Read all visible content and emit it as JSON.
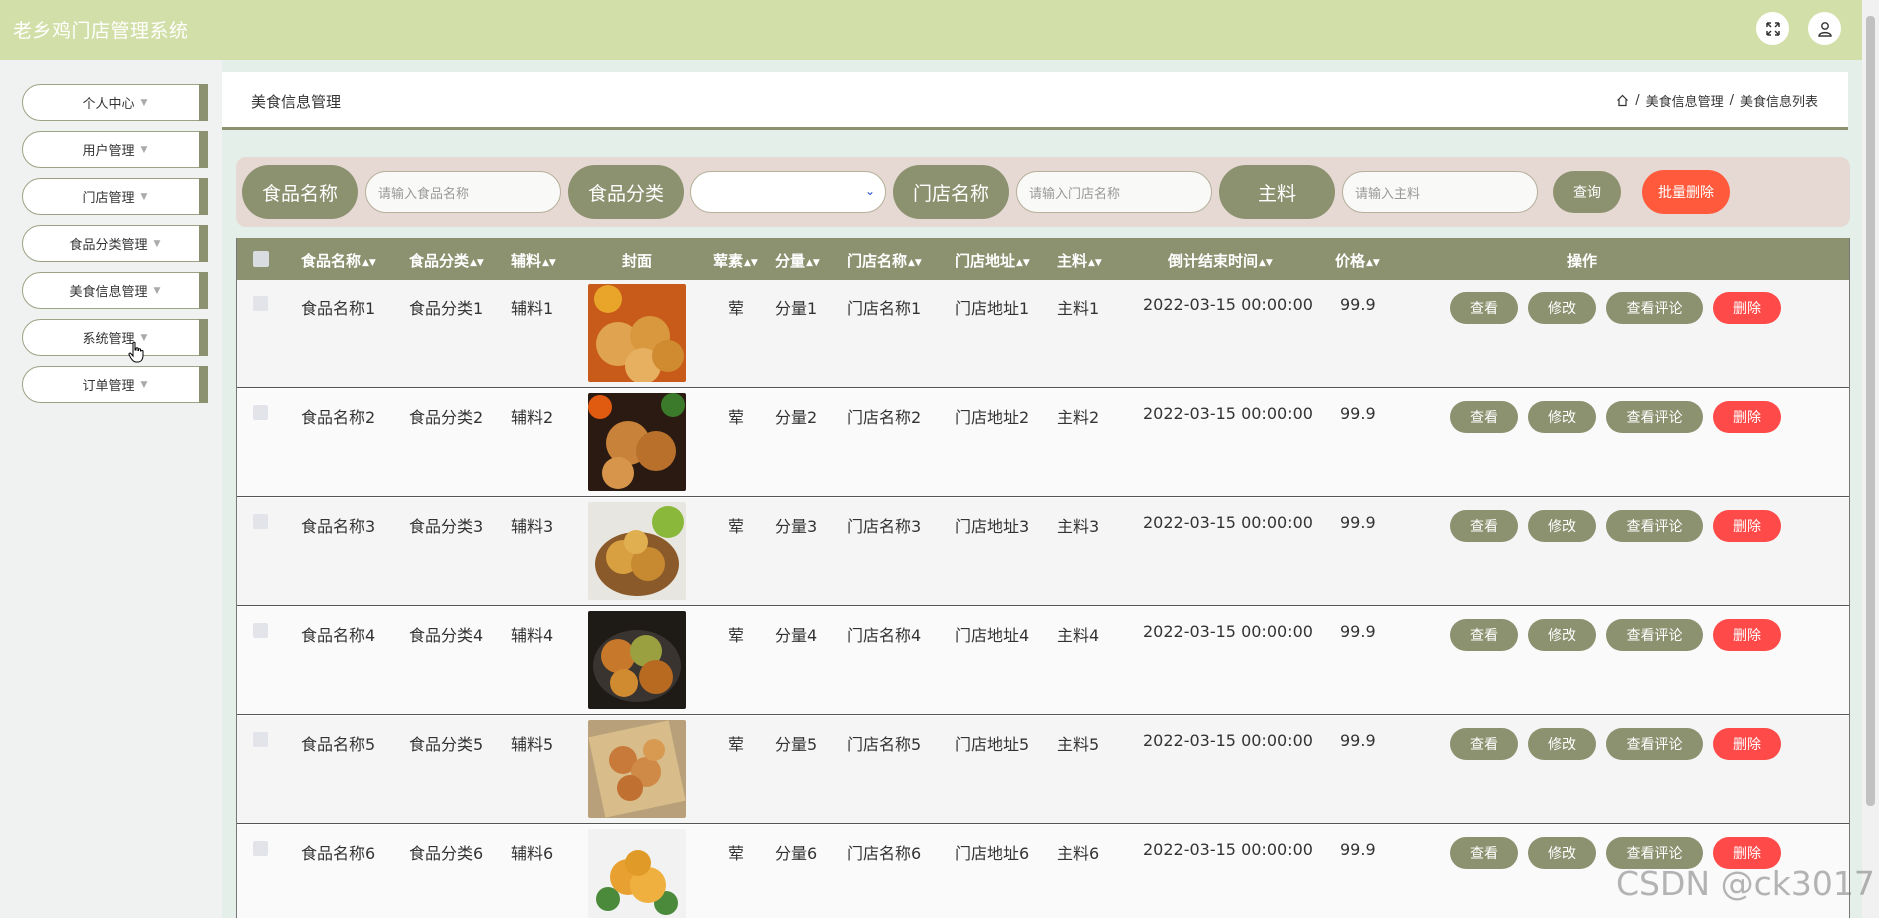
{
  "app": {
    "title": "老乡鸡门店管理系统"
  },
  "sidebar": {
    "items": [
      {
        "label": "个人中心"
      },
      {
        "label": "用户管理"
      },
      {
        "label": "门店管理"
      },
      {
        "label": "食品分类管理"
      },
      {
        "label": "美食信息管理"
      },
      {
        "label": "系统管理"
      },
      {
        "label": "订单管理"
      }
    ]
  },
  "page": {
    "title": "美食信息管理"
  },
  "breadcrumb": {
    "item1": "美食信息管理",
    "item2": "美食信息列表"
  },
  "search": {
    "food_name_label": "食品名称",
    "food_name_placeholder": "请输入食品名称",
    "category_label": "食品分类",
    "store_name_label": "门店名称",
    "store_name_placeholder": "请输入门店名称",
    "main_ingredient_label": "主料",
    "main_ingredient_placeholder": "请输入主料",
    "query_button": "查询",
    "batch_delete_button": "批量删除"
  },
  "table": {
    "columns": [
      "食品名称",
      "食品分类",
      "辅料",
      "封面",
      "荤素",
      "分量",
      "门店名称",
      "门店地址",
      "主料",
      "倒计结束时间",
      "价格",
      "操作"
    ],
    "rows": [
      {
        "name": "食品名称1",
        "category": "食品分类1",
        "side": "辅料1",
        "type": "荤",
        "portion": "分量1",
        "store": "门店名称1",
        "address": "门店地址1",
        "main": "主料1",
        "end_time": "2022-03-15 00:00:00",
        "price": "99.9"
      },
      {
        "name": "食品名称2",
        "category": "食品分类2",
        "side": "辅料2",
        "type": "荤",
        "portion": "分量2",
        "store": "门店名称2",
        "address": "门店地址2",
        "main": "主料2",
        "end_time": "2022-03-15 00:00:00",
        "price": "99.9"
      },
      {
        "name": "食品名称3",
        "category": "食品分类3",
        "side": "辅料3",
        "type": "荤",
        "portion": "分量3",
        "store": "门店名称3",
        "address": "门店地址3",
        "main": "主料3",
        "end_time": "2022-03-15 00:00:00",
        "price": "99.9"
      },
      {
        "name": "食品名称4",
        "category": "食品分类4",
        "side": "辅料4",
        "type": "荤",
        "portion": "分量4",
        "store": "门店名称4",
        "address": "门店地址4",
        "main": "主料4",
        "end_time": "2022-03-15 00:00:00",
        "price": "99.9"
      },
      {
        "name": "食品名称5",
        "category": "食品分类5",
        "side": "辅料5",
        "type": "荤",
        "portion": "分量5",
        "store": "门店名称5",
        "address": "门店地址5",
        "main": "主料5",
        "end_time": "2022-03-15 00:00:00",
        "price": "99.9"
      },
      {
        "name": "食品名称6",
        "category": "食品分类6",
        "side": "辅料6",
        "type": "荤",
        "portion": "分量6",
        "store": "门店名称6",
        "address": "门店地址6",
        "main": "主料6",
        "end_time": "2022-03-15 00:00:00",
        "price": "99.9"
      }
    ],
    "actions": {
      "view": "查看",
      "edit": "修改",
      "comments": "查看评论",
      "delete": "删除"
    }
  },
  "watermark": "CSDN @ck3017",
  "colors": {
    "header": "#d3dfa8",
    "accent": "#8c9270",
    "danger": "#ff4a4a",
    "batch_delete": "#ff5a3c"
  }
}
